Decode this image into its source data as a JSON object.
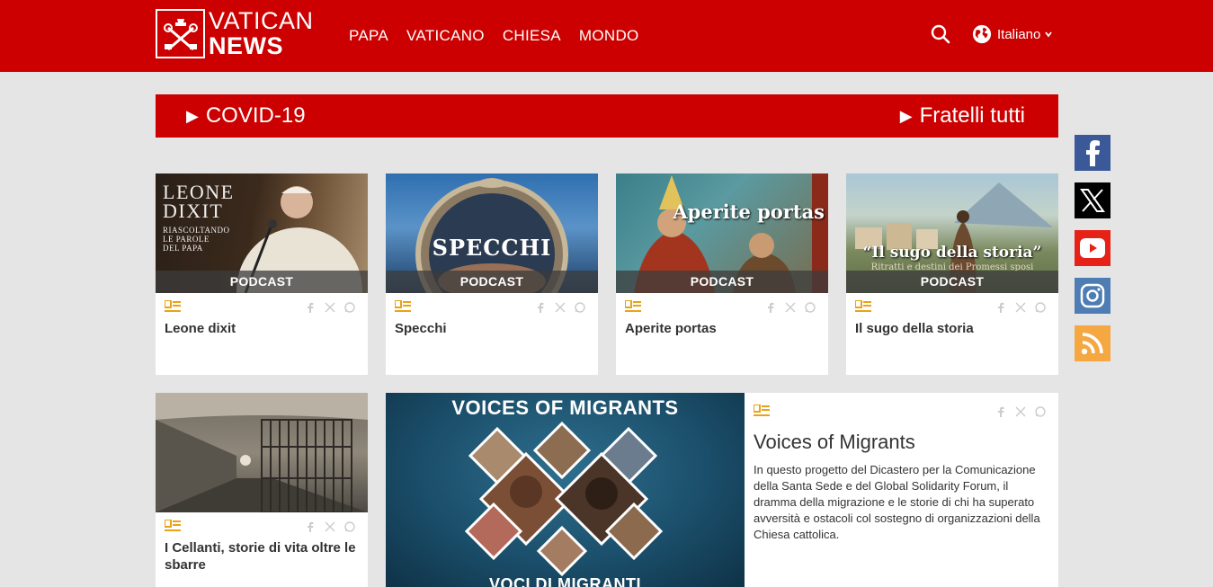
{
  "header": {
    "logo_top": "VATICAN",
    "logo_bottom": "NEWS",
    "nav": [
      "PAPA",
      "VATICANO",
      "CHIESA",
      "MONDO"
    ],
    "language": "Italiano",
    "brand_color": "#cc0000"
  },
  "banner": {
    "left_label": "COVID-19",
    "right_label": "Fratelli tutti"
  },
  "cards": [
    {
      "title": "Leone dixit",
      "tag": "PODCAST",
      "img_text_1": "LEONE",
      "img_text_2": "DIXIT",
      "img_text_3": "RIASCOLTANDO",
      "img_text_4": "LE PAROLE",
      "img_text_5": "DEL PAPA"
    },
    {
      "title": "Specchi",
      "tag": "PODCAST",
      "img_text": "SPECCHI"
    },
    {
      "title": "Aperite portas",
      "tag": "PODCAST",
      "img_text": "Aperite portas"
    },
    {
      "title": "Il sugo della storia",
      "tag": "PODCAST",
      "img_text": "“Il sugo della storia”",
      "img_subtext": "Ritratti e destini dei Promessi sposi"
    },
    {
      "title": "I Cellanti, storie di vita oltre le sbarre"
    }
  ],
  "hero": {
    "img_top": "VOICES OF MIGRANTS",
    "img_bottom": "VOCI DI MIGRANTI",
    "title": "Voices of Migrants",
    "description": "In questo progetto del Dicastero per la Comunicazione della Santa Sede e del Global Solidarity Forum, il dramma della migrazione e le storie di chi ha superato avversità e ostacoli col sostegno di organizzazioni della Chiesa cattolica."
  },
  "social": [
    {
      "name": "facebook",
      "color": "#3b5998"
    },
    {
      "name": "x",
      "color": "#000000"
    },
    {
      "name": "youtube",
      "color": "#e62117"
    },
    {
      "name": "instagram",
      "color": "#4e7db3"
    },
    {
      "name": "rss",
      "color": "#f5a742"
    }
  ]
}
